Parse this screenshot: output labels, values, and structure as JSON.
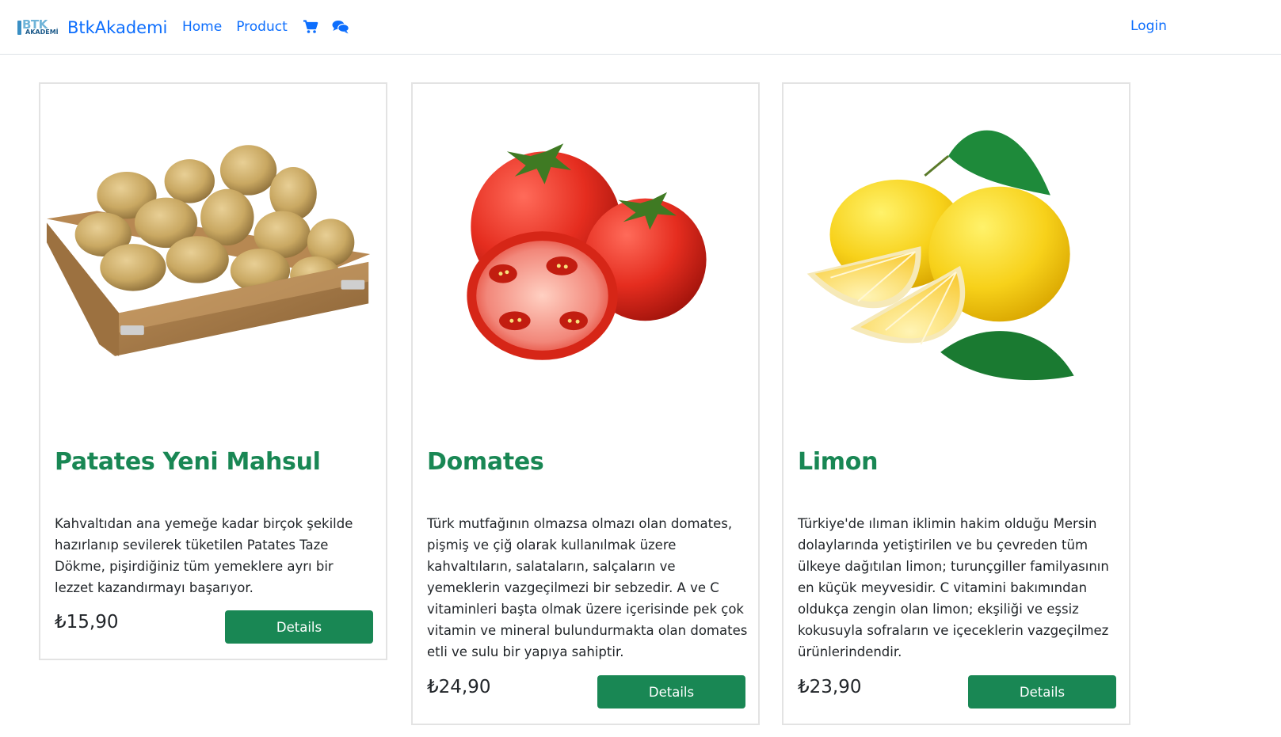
{
  "navbar": {
    "brand_logo_text": "BTK",
    "brand_logo_sub": "AKADEMİ",
    "brand_name": "BtkAkademi",
    "links": [
      {
        "label": "Home"
      },
      {
        "label": "Product"
      }
    ],
    "icons": [
      "shopping-cart-icon",
      "comments-icon"
    ],
    "login_label": "Login"
  },
  "products": [
    {
      "title": "Patates Yeni Mahsul",
      "description": "Kahvaltıdan ana yemeğe kadar birçok şekilde hazırlanıp sevilerek tüketilen Patates Taze Dökme, pişirdiğiniz tüm yemeklere ayrı bir lezzet kazandırmayı başarıyor.",
      "price": "₺15,90",
      "button_label": "Details",
      "image": "potatoes-in-wooden-crate"
    },
    {
      "title": "Domates",
      "description": "Türk mutfağının olmazsa olmazı olan domates, pişmiş ve çiğ olarak kullanılmak üzere kahvaltıların, salataların, salçaların ve yemeklerin vazgeçilmezi bir sebzedir. A ve C vitaminleri başta olmak üzere içerisinde pek çok vitamin ve mineral bulundurmakta olan domates etli ve sulu bir yapıya sahiptir.",
      "price": "₺24,90",
      "button_label": "Details",
      "image": "tomatoes-with-half-slice"
    },
    {
      "title": "Limon",
      "description": "Türkiye'de ılıman iklimin hakim olduğu Mersin dolaylarında yetiştirilen ve bu çevreden tüm ülkeye dağıtılan limon; turunçgiller familyasının en küçük meyvesidir. C vitamini bakımından oldukça zengin olan limon; ekşiliği ve eşsiz kokusuyla sofraların ve içeceklerin vazgeçilmez ürünlerindendir.",
      "price": "₺23,90",
      "button_label": "Details",
      "image": "lemons-with-slices-and-leaves"
    }
  ],
  "colors": {
    "link": "#0d6efd",
    "accent_green": "#198754",
    "card_border": "#e3e3e3"
  }
}
